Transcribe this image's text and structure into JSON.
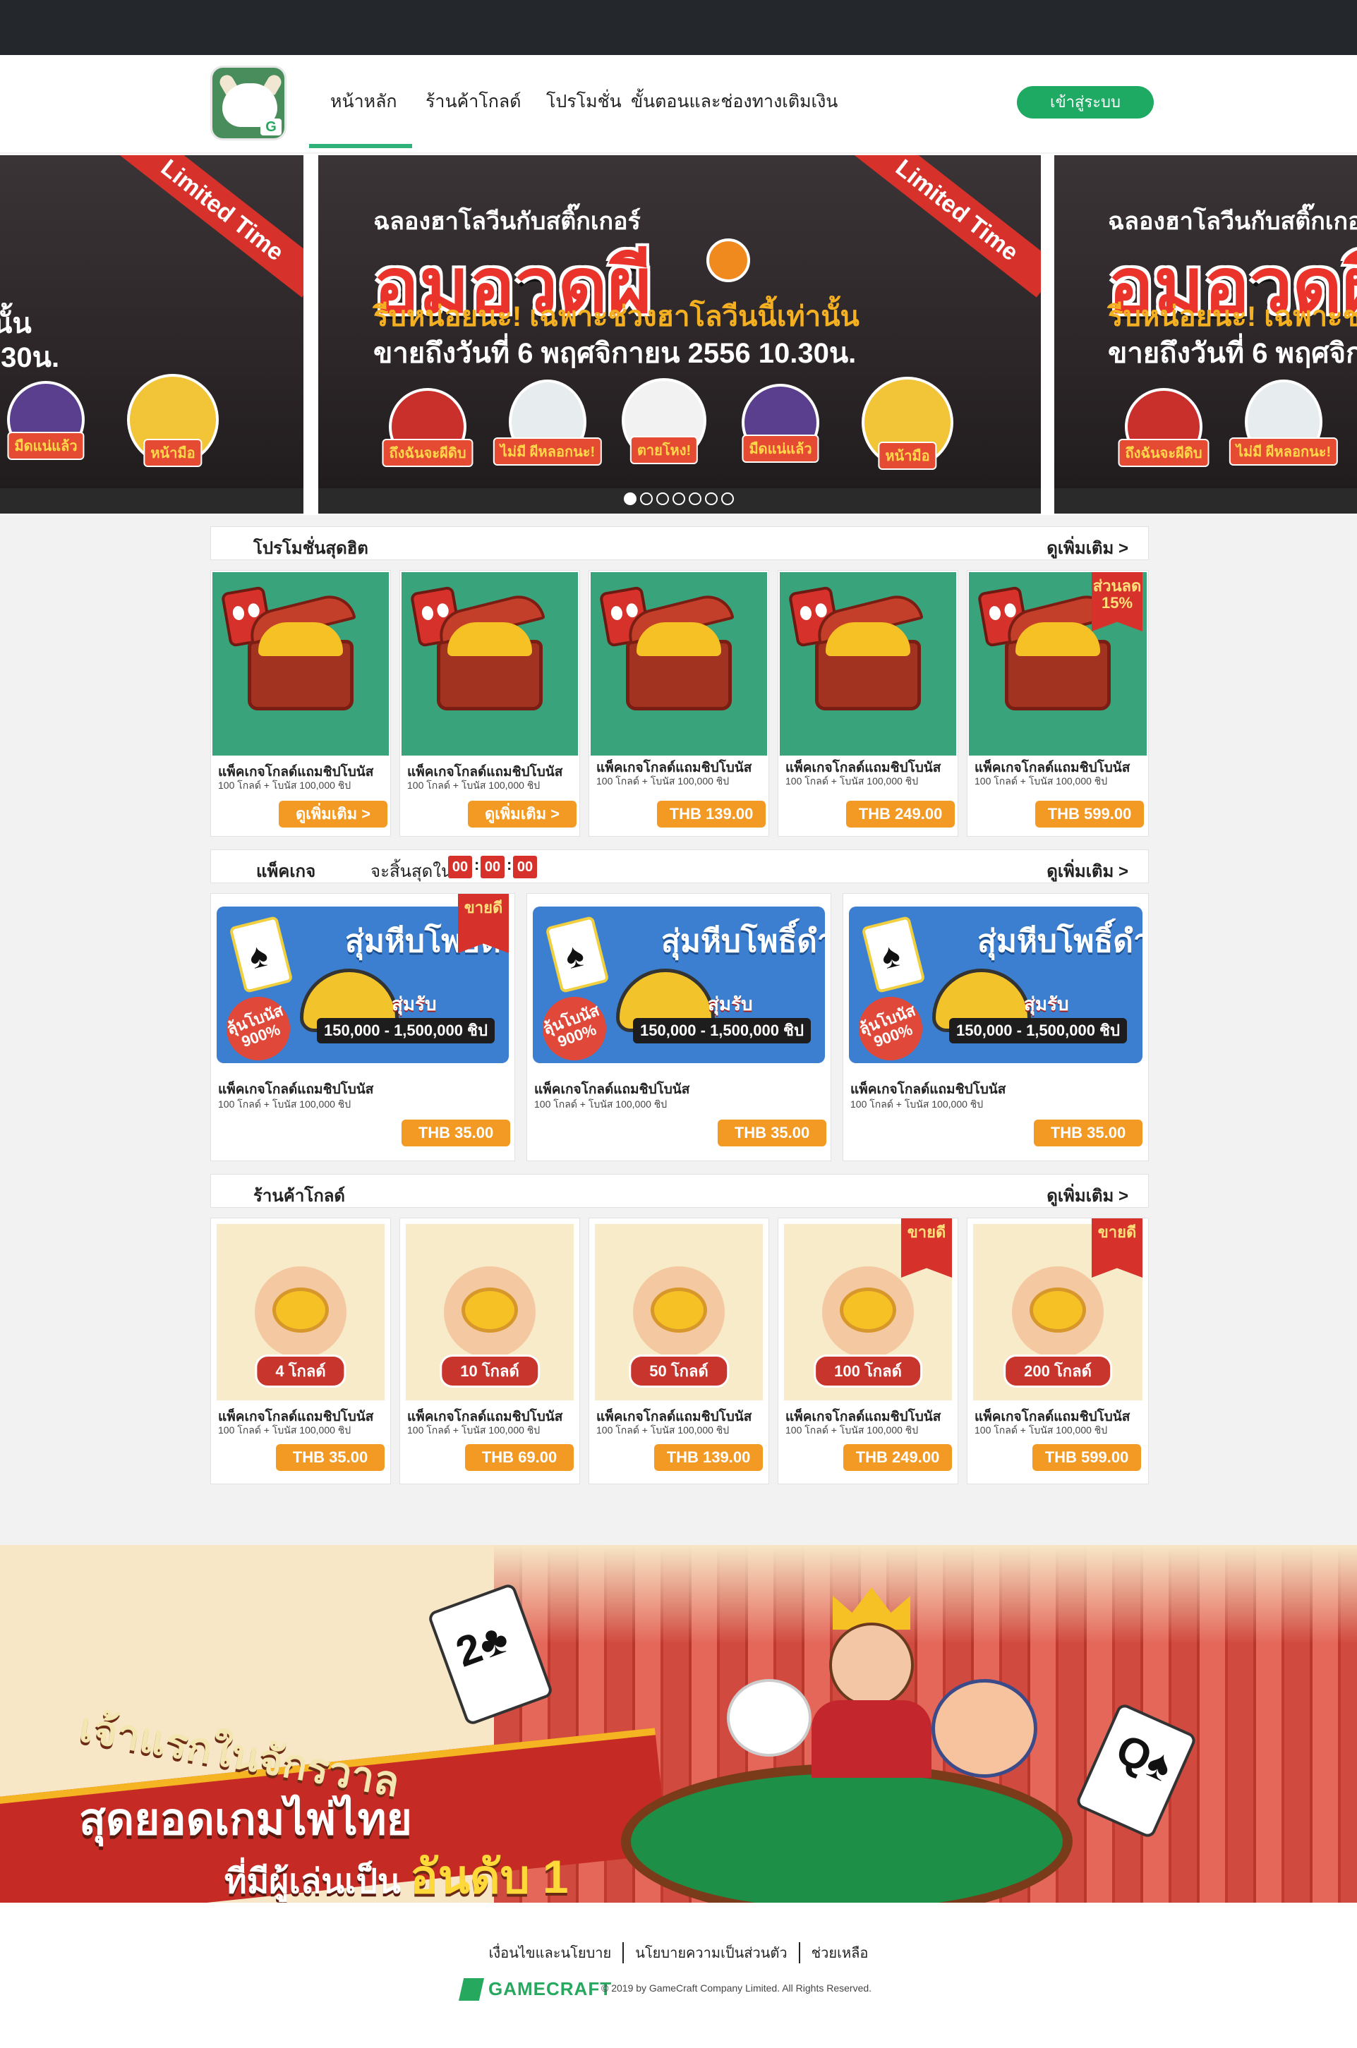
{
  "nav": {
    "items": [
      "หน้าหลัก",
      "ร้านค้าโกลด์",
      "โปรโมชั่น",
      "ขั้นตอนและช่องทางเติมเงิน"
    ],
    "active": "หน้าหลัก",
    "login": "เข้าสู่ระบบ"
  },
  "hero": {
    "ribbon": "Limited Time",
    "line1": "ฉลองฮาโลวีนกับสติ๊กเกอร์",
    "title": "อมอวดผี",
    "line2": "รีบหน่อยนะ! เฉพาะช่วงฮาโลวีนนี้เท่านั้น",
    "line3": "ขายถึงวันที่ 6 พฤศจิกายน 2556 10.30น.",
    "stickers": [
      "ถึงฉันจะผีดิบ",
      "ไม่มี ผีหลอกนะ!",
      "ตายโหง!",
      "มืดแน่แล้ว",
      "หน้ามือ"
    ],
    "dots": 7,
    "active_dot": 1
  },
  "promo": {
    "title": "โปรโมชั่นสุดฮิต",
    "more": "ดูเพิ่มเติม >",
    "items": [
      {
        "name": "แพ็คเกจโกลด์แถมชิปโบนัส",
        "desc": "100 โกลด์ + โบนัส 100,000 ชิป",
        "button": "ดูเพิ่มเติม >"
      },
      {
        "name": "แพ็คเกจโกลด์แถมชิปโบนัส",
        "desc": "100 โกลด์ + โบนัส 100,000 ชิป",
        "button": "ดูเพิ่มเติม >"
      },
      {
        "name": "แพ็คเกจโกลด์แถมชิปโบนัส",
        "desc": "100 โกลด์ + โบนัส 100,000 ชิป",
        "button": "THB 139.00"
      },
      {
        "name": "แพ็คเกจโกลด์แถมชิปโบนัส",
        "desc": "100 โกลด์ + โบนัส 100,000 ชิป",
        "button": "THB 249.00"
      },
      {
        "name": "แพ็คเกจโกลด์แถมชิปโบนัส",
        "desc": "100 โกลด์ + โบนัส 100,000 ชิป",
        "button": "THB 599.00",
        "flag": "ส่วนลด 15%"
      }
    ]
  },
  "package": {
    "title": "แพ็คเกจ",
    "countdown_label": "จะสิ้นสุดใน",
    "countdown": [
      "00",
      "00",
      "00"
    ],
    "more": "ดูเพิ่มเติม >",
    "banner_title": "สุ่มหีบโพธิ์ดำ",
    "banner_range": "150,000 - 1,500,000 ชิป",
    "banner_bonus": "สุ่มรับ",
    "banner_pct": "ลุ้นโบนัส 900%",
    "items": [
      {
        "name": "แพ็คเกจโกลด์แถมชิปโบนัส",
        "desc": "100 โกลด์ + โบนัส 100,000 ชิป",
        "price": "THB 35.00",
        "flag": "ขายดี"
      },
      {
        "name": "แพ็คเกจโกลด์แถมชิปโบนัส",
        "desc": "100 โกลด์ + โบนัส 100,000 ชิป",
        "price": "THB 35.00"
      },
      {
        "name": "แพ็คเกจโกลด์แถมชิปโบนัส",
        "desc": "100 โกลด์ + โบนัส 100,000 ชิป",
        "price": "THB 35.00"
      }
    ]
  },
  "gold_shop": {
    "title": "ร้านค้าโกลด์",
    "more": "ดูเพิ่มเติม >",
    "items": [
      {
        "qty": "4 โกลด์",
        "name": "แพ็คเกจโกลด์แถมชิปโบนัส",
        "desc": "100 โกลด์ + โบนัส 100,000 ชิป",
        "price": "THB 35.00"
      },
      {
        "qty": "10 โกลด์",
        "name": "แพ็คเกจโกลด์แถมชิปโบนัส",
        "desc": "100 โกลด์ + โบนัส 100,000 ชิป",
        "price": "THB 69.00"
      },
      {
        "qty": "50 โกลด์",
        "name": "แพ็คเกจโกลด์แถมชิปโบนัส",
        "desc": "100 โกลด์ + โบนัส 100,000 ชิป",
        "price": "THB 139.00"
      },
      {
        "qty": "100 โกลด์",
        "name": "แพ็คเกจโกลด์แถมชิปโบนัส",
        "desc": "100 โกลด์ + โบนัส 100,000 ชิป",
        "price": "THB 249.00",
        "flag": "ขายดี"
      },
      {
        "qty": "200 โกลด์",
        "name": "แพ็คเกจโกลด์แถมชิปโบนัส",
        "desc": "100 โกลด์ + โบนัส 100,000 ชิป",
        "price": "THB 599.00",
        "flag": "ขายดี"
      }
    ]
  },
  "bottom_banner": {
    "line1": "เจ้าแรกในจักรวาล",
    "line2": "สุดยอดเกมไพ่ไทย",
    "line3a": "ที่มีผู้เล่นเป็น",
    "line3b": "อันดับ 1",
    "card_left": "2♣",
    "card_right": "Q♠"
  },
  "footer": {
    "links": [
      "เงื่อนไขและนโยบาย",
      "นโยบายความเป็นส่วนตัว",
      "ช่วยเหลือ"
    ],
    "brand": "GAMECRAFT",
    "copyright": "© 2019 by GameCraft Company Limited. All Rights Reserved."
  },
  "colors": {
    "brand_green": "#1faa64",
    "price_orange": "#f29a24",
    "flag_red": "#d6312a",
    "topbar": "#24282c"
  }
}
